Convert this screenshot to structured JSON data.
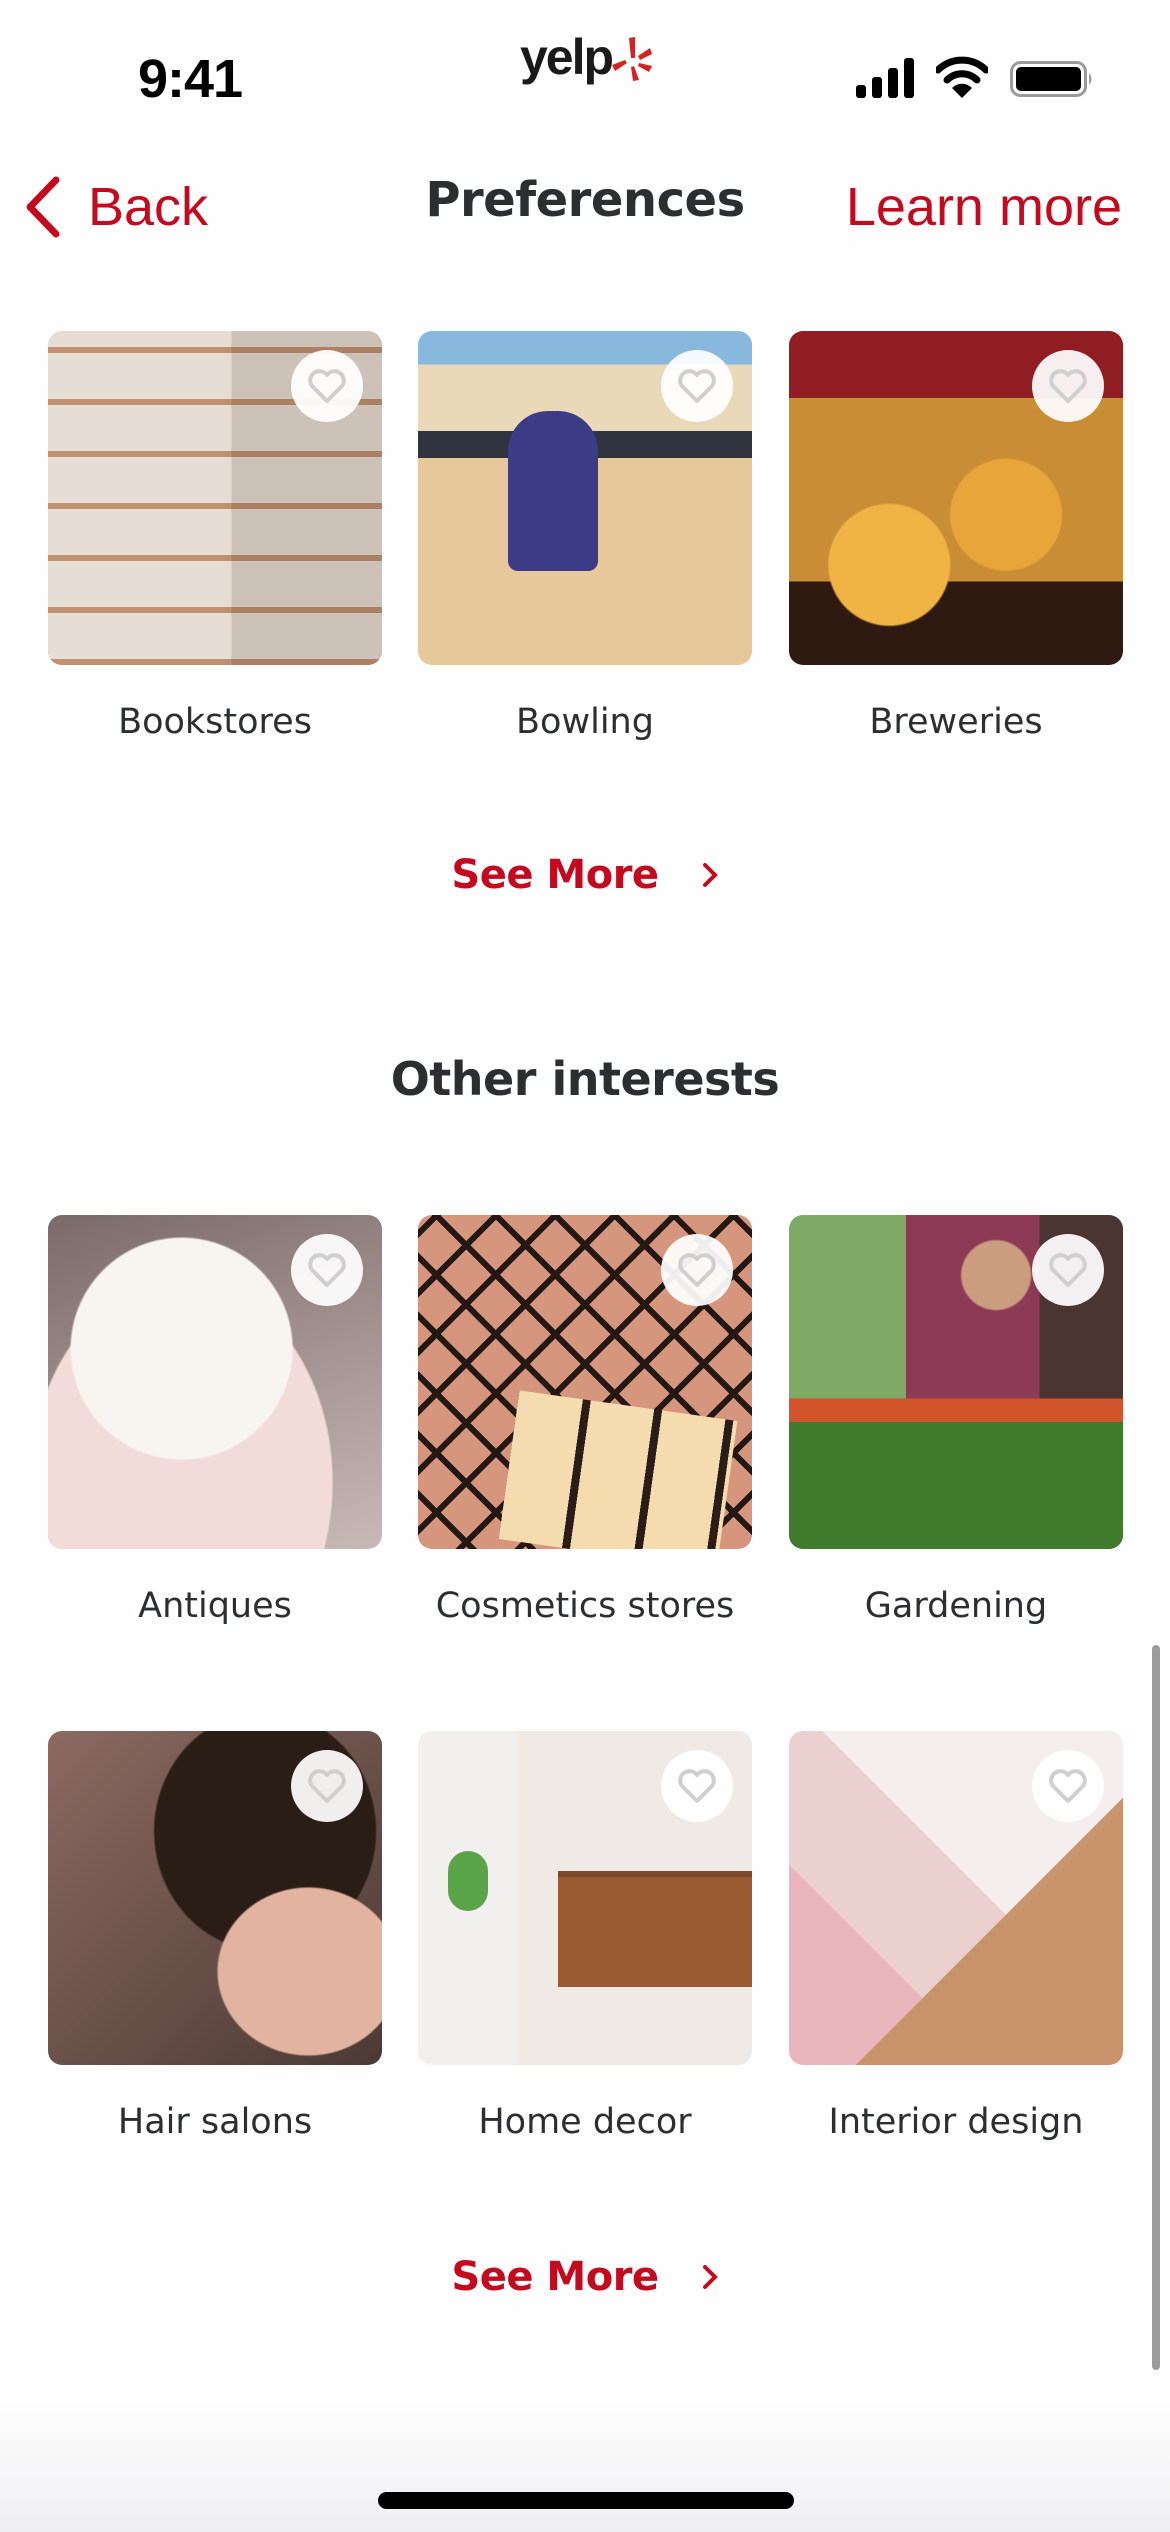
{
  "status_bar": {
    "time": "9:41",
    "logo_text": "yelp",
    "icons": [
      "signal-icon",
      "wifi-icon",
      "battery-icon"
    ]
  },
  "nav": {
    "back_label": "Back",
    "title": "Preferences",
    "learn_more_label": "Learn more"
  },
  "colors": {
    "brand_red": "#d32323",
    "link_red": "#c40a1e",
    "text_dark": "#2d2e2f"
  },
  "sections": [
    {
      "title": "",
      "cards": [
        {
          "label": "Bookstores",
          "image": "bookshelves",
          "favorited": false
        },
        {
          "label": "Bowling",
          "image": "child-bowling",
          "favorited": false
        },
        {
          "label": "Breweries",
          "image": "beer-glasses",
          "favorited": false
        }
      ],
      "see_more_label": "See More"
    },
    {
      "title": "Other interests",
      "cards": [
        {
          "label": "Antiques",
          "image": "teacups",
          "favorited": false
        },
        {
          "label": "Cosmetics stores",
          "image": "eyeshadow-palettes",
          "favorited": false
        },
        {
          "label": "Gardening",
          "image": "man-in-greenhouse",
          "favorited": false
        },
        {
          "label": "Hair salons",
          "image": "barber-haircut",
          "favorited": false
        },
        {
          "label": "Home decor",
          "image": "bench-and-cactus",
          "favorited": false
        },
        {
          "label": "Interior design",
          "image": "fabric-swatches",
          "favorited": false
        }
      ],
      "see_more_label": "See More"
    }
  ]
}
